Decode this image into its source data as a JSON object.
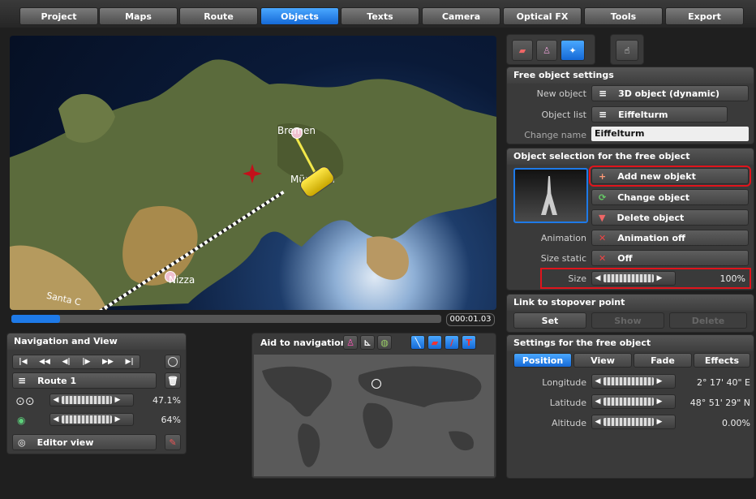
{
  "menu": [
    "Project",
    "Maps",
    "Route",
    "Objects",
    "Texts",
    "Camera",
    "Optical FX",
    "Tools",
    "Export"
  ],
  "map_labels": {
    "bremen": "Bremen",
    "munich": "München",
    "nizza": "Nizza",
    "santa": "Santa C"
  },
  "timecode": "000:01.03",
  "nav": {
    "title": "Navigation and View",
    "route": "Route 1",
    "zoom_value": "47.1%",
    "zoom_level": 0.471,
    "tilt_value": "64%",
    "tilt_level": 0.64,
    "view": "Editor view"
  },
  "aid": {
    "title": "Aid to navigation"
  },
  "free": {
    "title": "Free object settings",
    "new_object_label": "New object",
    "new_object_value": "3D object (dynamic)",
    "object_list_label": "Object list",
    "object_list_value": "Eiffelturm",
    "change_name_label": "Change name",
    "change_name_value": "Eiffelturm"
  },
  "selection": {
    "title": "Object selection for the free object",
    "add": "Add new objekt",
    "change": "Change object",
    "delete": "Delete object",
    "animation_label": "Animation",
    "animation_value": "Animation off",
    "size_static_label": "Size static",
    "size_static_value": "Off",
    "size_label": "Size",
    "size_value": "100%",
    "size_level": 1.0
  },
  "stopover": {
    "title": "Link to stopover point",
    "set": "Set",
    "show": "Show",
    "delete": "Delete"
  },
  "settings": {
    "title": "Settings for the free object",
    "tabs": [
      "Position",
      "View",
      "Fade",
      "Effects"
    ],
    "longitude_label": "Longitude",
    "longitude_value": "2° 17' 40\" E",
    "latitude_label": "Latitude",
    "latitude_value": "48° 51' 29\" N",
    "altitude_label": "Altitude",
    "altitude_value": "0.00%"
  },
  "colors": {
    "accent": "#1e7ae8",
    "highlight": "#e0141c"
  }
}
